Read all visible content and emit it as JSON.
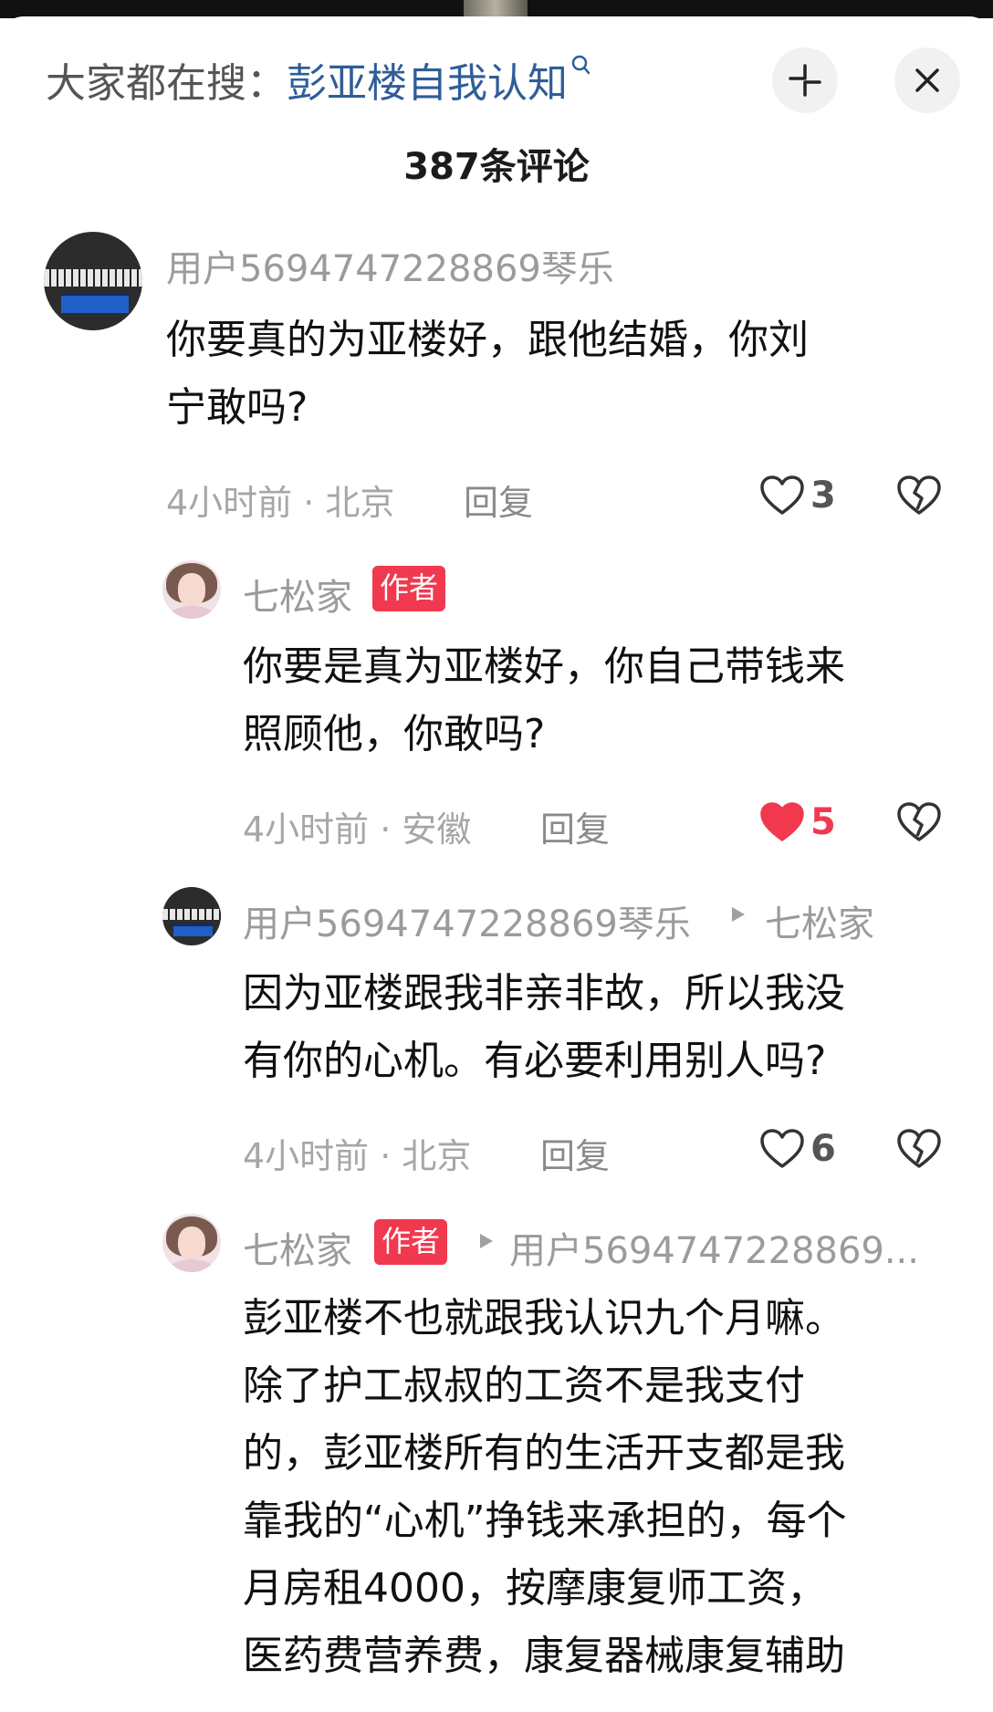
{
  "header": {
    "search_prefix": "大家都在搜：",
    "search_term": "彭亚楼自我认知",
    "search_icon": "search-icon",
    "collapse_icon": "collapse-icon",
    "close_icon": "close-icon",
    "comment_count_title": "387条评论"
  },
  "comments": [
    {
      "user": "用户5694747228869琴乐",
      "text_lines": [
        "你要真的为亚楼好，跟他结婚，你刘",
        "宁敢吗?"
      ],
      "meta": "4小时前 · 北京",
      "reply_label": "回复",
      "likes": "3",
      "liked": false
    },
    {
      "user": "七松家",
      "badge": "作者",
      "text_lines": [
        "你要是真为亚楼好，你自己带钱来",
        "照顾他，你敢吗?"
      ],
      "meta": "4小时前 · 安徽",
      "reply_label": "回复",
      "likes": "5",
      "liked": true
    },
    {
      "user": "用户5694747228869琴乐",
      "reply_to": "七松家",
      "text_lines": [
        "因为亚楼跟我非亲非故，所以我没",
        "有你的心机。有必要利用别人吗?"
      ],
      "meta": "4小时前 · 北京",
      "reply_label": "回复",
      "likes": "6",
      "liked": false
    },
    {
      "user": "七松家",
      "badge": "作者",
      "reply_to": "用户5694747228869...",
      "text_lines": [
        "彭亚楼不也就跟我认识九个月嘛。",
        "除了护工叔叔的工资不是我支付",
        "的，彭亚楼所有的生活开支都是我",
        "靠我的“心机”挣钱来承担的，每个",
        "月房租4000，按摩康复师工资，",
        "医药费营养费，康复器械康复辅助"
      ]
    }
  ],
  "colors": {
    "accent_red": "#f0394f",
    "link_blue": "#2f5d99",
    "meta_gray": "#a6a6a6"
  }
}
